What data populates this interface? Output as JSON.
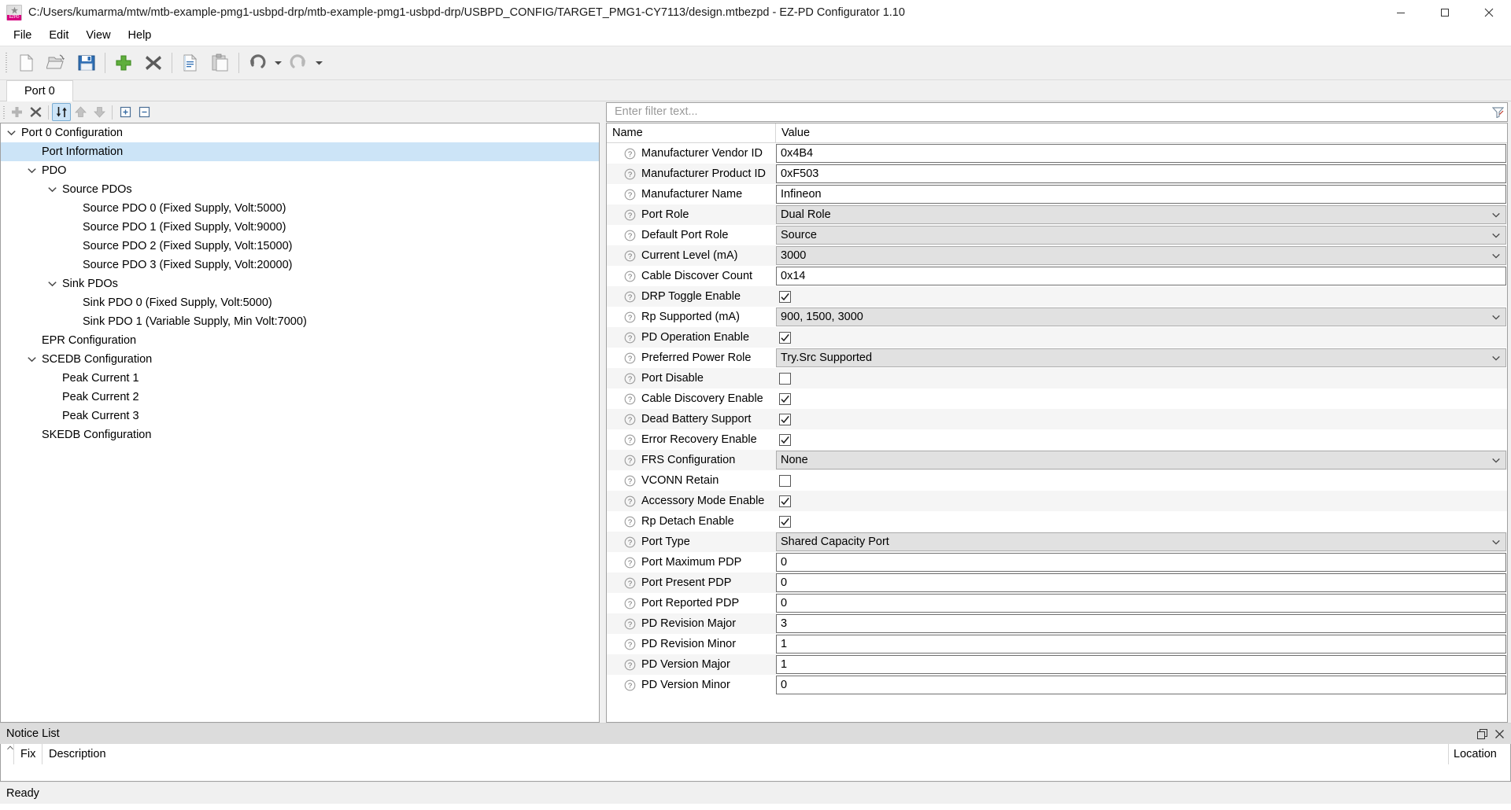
{
  "window": {
    "title": "C:/Users/kumarma/mtw/mtb-example-pmg1-usbpd-drp/mtb-example-pmg1-usbpd-drp/USBPD_CONFIG/TARGET_PMG1-CY7113/design.mtbezpd - EZ-PD Configurator 1.10",
    "minimize_label": "Minimize",
    "maximize_label": "Maximize",
    "close_label": "Close"
  },
  "menu": {
    "items": [
      {
        "label": "File"
      },
      {
        "label": "Edit"
      },
      {
        "label": "View"
      },
      {
        "label": "Help"
      }
    ]
  },
  "toolbar": {
    "buttons": [
      {
        "name": "new-file-icon",
        "tooltip": "New"
      },
      {
        "name": "open-folder-icon",
        "tooltip": "Open"
      },
      {
        "name": "save-icon",
        "tooltip": "Save"
      },
      {
        "name": "add-icon",
        "tooltip": "Add"
      },
      {
        "name": "delete-icon",
        "tooltip": "Delete"
      },
      {
        "name": "copy-icon",
        "tooltip": "Copy"
      },
      {
        "name": "paste-icon",
        "tooltip": "Paste"
      },
      {
        "name": "undo-icon",
        "tooltip": "Undo"
      },
      {
        "name": "redo-icon",
        "tooltip": "Redo"
      }
    ]
  },
  "tabs": [
    {
      "label": "Port 0",
      "active": true
    }
  ],
  "tree_toolbar": {
    "buttons": [
      {
        "name": "tree-add-icon",
        "tooltip": "Add",
        "active": false
      },
      {
        "name": "tree-delete-icon",
        "tooltip": "Delete",
        "active": false
      },
      {
        "name": "tree-sort-icon",
        "tooltip": "Sort",
        "active": true
      },
      {
        "name": "tree-move-up-icon",
        "tooltip": "Move Up",
        "active": false
      },
      {
        "name": "tree-move-down-icon",
        "tooltip": "Move Down",
        "active": false
      },
      {
        "name": "tree-expand-all-icon",
        "tooltip": "Expand All",
        "active": false
      },
      {
        "name": "tree-collapse-all-icon",
        "tooltip": "Collapse All",
        "active": false
      }
    ]
  },
  "tree": {
    "items": [
      {
        "label": "Port 0 Configuration",
        "depth": 0,
        "expander": "expanded",
        "selected": false
      },
      {
        "label": "Port Information",
        "depth": 1,
        "expander": "none",
        "selected": true
      },
      {
        "label": "PDO",
        "depth": 1,
        "expander": "expanded",
        "selected": false
      },
      {
        "label": "Source PDOs",
        "depth": 2,
        "expander": "expanded",
        "selected": false
      },
      {
        "label": "Source PDO 0 (Fixed Supply, Volt:5000)",
        "depth": 3,
        "expander": "none",
        "selected": false
      },
      {
        "label": "Source PDO 1 (Fixed Supply, Volt:9000)",
        "depth": 3,
        "expander": "none",
        "selected": false
      },
      {
        "label": "Source PDO 2 (Fixed Supply, Volt:15000)",
        "depth": 3,
        "expander": "none",
        "selected": false
      },
      {
        "label": "Source PDO 3 (Fixed Supply, Volt:20000)",
        "depth": 3,
        "expander": "none",
        "selected": false
      },
      {
        "label": "Sink PDOs",
        "depth": 2,
        "expander": "expanded",
        "selected": false
      },
      {
        "label": "Sink PDO 0 (Fixed Supply, Volt:5000)",
        "depth": 3,
        "expander": "none",
        "selected": false
      },
      {
        "label": "Sink PDO 1 (Variable Supply, Min Volt:7000)",
        "depth": 3,
        "expander": "none",
        "selected": false
      },
      {
        "label": "EPR Configuration",
        "depth": 1,
        "expander": "none",
        "selected": false
      },
      {
        "label": "SCEDB Configuration",
        "depth": 1,
        "expander": "expanded",
        "selected": false
      },
      {
        "label": "Peak Current 1",
        "depth": 2,
        "expander": "none",
        "selected": false
      },
      {
        "label": "Peak Current 2",
        "depth": 2,
        "expander": "none",
        "selected": false
      },
      {
        "label": "Peak Current 3",
        "depth": 2,
        "expander": "none",
        "selected": false
      },
      {
        "label": "SKEDB Configuration",
        "depth": 1,
        "expander": "none",
        "selected": false
      }
    ]
  },
  "filter": {
    "value": "",
    "placeholder": "Enter filter text...",
    "icon": "filter-icon"
  },
  "properties": {
    "columns": {
      "name": "Name",
      "value": "Value"
    },
    "rows": [
      {
        "name": "Manufacturer Vendor ID",
        "type": "text",
        "value": "0x4B4"
      },
      {
        "name": "Manufacturer Product ID",
        "type": "text",
        "value": "0xF503"
      },
      {
        "name": "Manufacturer Name",
        "type": "text",
        "value": "Infineon"
      },
      {
        "name": "Port Role",
        "type": "combo",
        "value": "Dual Role"
      },
      {
        "name": "Default Port Role",
        "type": "combo",
        "value": "Source"
      },
      {
        "name": "Current Level (mA)",
        "type": "combo",
        "value": "3000"
      },
      {
        "name": "Cable Discover Count",
        "type": "text",
        "value": "0x14"
      },
      {
        "name": "DRP Toggle Enable",
        "type": "checkbox",
        "value": true
      },
      {
        "name": "Rp Supported (mA)",
        "type": "combo",
        "value": "900, 1500, 3000"
      },
      {
        "name": "PD Operation Enable",
        "type": "checkbox",
        "value": true
      },
      {
        "name": "Preferred Power Role",
        "type": "combo",
        "value": "Try.Src Supported"
      },
      {
        "name": "Port Disable",
        "type": "checkbox",
        "value": false
      },
      {
        "name": "Cable Discovery Enable",
        "type": "checkbox",
        "value": true
      },
      {
        "name": "Dead Battery Support",
        "type": "checkbox",
        "value": true
      },
      {
        "name": "Error Recovery Enable",
        "type": "checkbox",
        "value": true
      },
      {
        "name": "FRS Configuration",
        "type": "combo",
        "value": "None"
      },
      {
        "name": "VCONN Retain",
        "type": "checkbox",
        "value": false
      },
      {
        "name": "Accessory Mode Enable",
        "type": "checkbox",
        "value": true
      },
      {
        "name": "Rp Detach Enable",
        "type": "checkbox",
        "value": true
      },
      {
        "name": "Port Type",
        "type": "combo",
        "value": "Shared Capacity Port"
      },
      {
        "name": "Port Maximum PDP",
        "type": "text",
        "value": "0"
      },
      {
        "name": "Port Present PDP",
        "type": "text",
        "value": "0"
      },
      {
        "name": "Port Reported PDP",
        "type": "text",
        "value": "0"
      },
      {
        "name": "PD Revision Major",
        "type": "text",
        "value": "3"
      },
      {
        "name": "PD Revision Minor",
        "type": "text",
        "value": "1"
      },
      {
        "name": "PD Version Major",
        "type": "text",
        "value": "1"
      },
      {
        "name": "PD Version Minor",
        "type": "text",
        "value": "0"
      }
    ]
  },
  "notice_list": {
    "title": "Notice List",
    "restore_label": "Restore",
    "close_label": "Close",
    "columns": {
      "fix": "Fix",
      "description": "Description",
      "location": "Location"
    },
    "rows": []
  },
  "statusbar": {
    "message": "Ready"
  },
  "colors": {
    "selection": "#cce4f7",
    "toolbar_bg": "#f0f0f0",
    "alt_row": "#f5f5f5",
    "combo_bg": "#e1e1e1",
    "accent_pink": "#d6007f"
  }
}
